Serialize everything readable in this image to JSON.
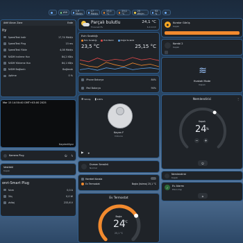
{
  "topbar": {
    "chips": [
      {
        "icon": "home-icon",
        "label": ""
      },
      {
        "icon": "wifi-icon",
        "label": "Wifi"
      },
      {
        "icon": "speed-icon",
        "label": "1,9 Mbit/s"
      },
      {
        "icon": "download-icon",
        "label": "17 Mbit/s"
      },
      {
        "icon": "thermo-icon",
        "label": "25,1 °C"
      },
      {
        "icon": "thermo-icon",
        "label": "25,1 °C"
      },
      {
        "icon": "sun-icon",
        "label": "25 Wh/m"
      },
      {
        "icon": "drop-icon",
        "label": "52 %"
      },
      {
        "icon": "menu-icon",
        "label": ""
      }
    ]
  },
  "colors": {
    "accent": "#f28a2e",
    "border": "#2f5c8a",
    "card": "#1f2328"
  },
  "router": {
    "header": {
      "left": "Aktif Alınan Zone",
      "right": "Evde"
    },
    "title": "ity",
    "rows": [
      {
        "label": "SpeedTest Indir",
        "value": "17,74 Mbit/s"
      },
      {
        "label": "SpeedTest Ping",
        "value": "15 ms"
      },
      {
        "label": "SpeedTest Yükle",
        "value": "4,08 Mbit/s"
      },
      {
        "label": "AVDM Indirme Hızı",
        "value": "84,2 KB/s"
      },
      {
        "label": "AVDM Yükleme Hızı",
        "value": "84,1 KB/s"
      },
      {
        "label": "AVDM Bağlantı",
        "value": "Bağlandı"
      },
      {
        "label": "Uptime",
        "value": "0 %"
      }
    ]
  },
  "clock": {
    "datetime": "Mar 15 14:50:40 GMT+03:00 2025",
    "caption": "Kaydediliyor"
  },
  "plug_card": {
    "label": "Kamera Plug"
  },
  "vestibule": {
    "title": "Vestibül",
    "state": "Kapalı"
  },
  "smart_plug": {
    "title": "onri-Smart Plug",
    "rows": [
      {
        "label": "Akım",
        "value": "0,0 A"
      },
      {
        "label": "Güç",
        "value": "0,0 W"
      },
      {
        "label": "Voltaj",
        "value": "233,6 V"
      }
    ]
  },
  "weather": {
    "condition": "Parçalı bulutlu",
    "sub": "Forecast Ev",
    "temp": "24,1 °C",
    "sub_right": "6,4 km/h"
  },
  "climate": {
    "title": "Evin Sıcaklığı",
    "legend": [
      "Evin Sıcaklığı",
      "Evin Nemi",
      "Doğal Sıcaklık"
    ],
    "left_value": "23,5 °C",
    "right_value": "25,15 °C",
    "lines": [
      {
        "label": "Evin Sıcaklığı",
        "values": [
          24.0,
          23.6,
          23.4,
          24.2,
          23.8,
          23.5,
          24.1,
          23.7,
          23.9,
          23.5
        ]
      },
      {
        "label": "Evin Nemi",
        "values": [
          24.6,
          24.3,
          24.9,
          24.4,
          24.7,
          24.5,
          25.0,
          24.6,
          24.8,
          24.5
        ]
      },
      {
        "label": "Doğal Sıcaklık",
        "values": [
          23.0,
          23.2,
          22.9,
          23.3,
          23.1,
          23.4,
          23.0,
          23.2,
          23.3,
          23.1
        ]
      }
    ]
  },
  "batteries": [
    {
      "label": "iPhone Batarya",
      "value": "84%"
    },
    {
      "label": "iPad Batarya",
      "value": "90%"
    }
  ],
  "vacuum": {
    "top_left": "Sönüş",
    "top_right": "100%",
    "name": "Kayan F",
    "state": "Dokuna"
  },
  "door_sensor": {
    "title": "Duman Sensörü",
    "state": "Normal"
  },
  "motion": {
    "label": "Hareket Kanala"
  },
  "ev_termostat_small": {
    "label": "Ev Termostat",
    "right_label": "Boşta (Isıtma)",
    "right_value": "25,1 °C"
  },
  "thermostat": {
    "title": "Ev Termostat",
    "mode": "Boşta",
    "setpoint": "24",
    "unit": "°C",
    "current": "25,1 °C",
    "level": 0.72
  },
  "cleaner": {
    "title": "Kuralar Görüş",
    "state": "Kapalı"
  },
  "kombi": {
    "title": "Kombi 2",
    "state": "Kapalı"
  },
  "hvac": {
    "title": "Hvakah Mode",
    "state": "Kapalı"
  },
  "humidifier": {
    "title": "Nemlendirici",
    "state": "Kapalı",
    "setpoint": "24",
    "unit": "%",
    "level": 0.62
  },
  "nemlendirici_small": {
    "title": "Nemlendirici",
    "state": "Kapalı"
  },
  "ev_alarm": {
    "title": "Ev Alarmı",
    "state": "Etkin Dışı"
  }
}
